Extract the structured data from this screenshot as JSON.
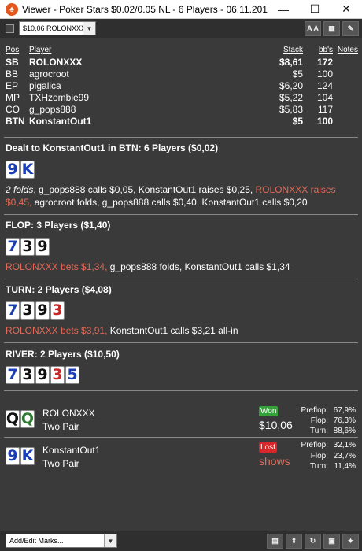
{
  "window": {
    "title": "Viewer - Poker Stars $0.02/0.05 NL - 6 Players - 06.11.2019 5:05",
    "app_icon": "pokerstars-icon",
    "controls": [
      "minimize-icon",
      "maximize-icon",
      "close-icon"
    ]
  },
  "toolbar": {
    "player_select": "$10,06 ROLONXXX",
    "buttons": [
      {
        "name": "text-size-button",
        "label": "A A"
      },
      {
        "name": "grid-button",
        "label": "▦"
      },
      {
        "name": "edit-button",
        "label": "✎"
      }
    ]
  },
  "players_table": {
    "headers": {
      "pos": "Pos",
      "player": "Player",
      "stack": "Stack",
      "bb": "bb's",
      "notes": "Notes"
    },
    "rows": [
      {
        "pos": "SB",
        "player": "ROLONXXX",
        "stack": "$8,61",
        "bb": "172",
        "bold": true
      },
      {
        "pos": "BB",
        "player": "agrocroot",
        "stack": "$5",
        "bb": "100",
        "bold": false
      },
      {
        "pos": "EP",
        "player": "pigalica",
        "stack": "$6,20",
        "bb": "124",
        "bold": false
      },
      {
        "pos": "MP",
        "player": "TXHzombie99",
        "stack": "$5,22",
        "bb": "104",
        "bold": false
      },
      {
        "pos": "CO",
        "player": "g_pops888",
        "stack": "$5,83",
        "bb": "117",
        "bold": false
      },
      {
        "pos": "BTN",
        "player": "KonstantOut1",
        "stack": "$5",
        "bb": "100",
        "bold": true
      }
    ]
  },
  "preflop": {
    "title": "Dealt to KonstantOut1 in BTN: 6 Players ($0,02)",
    "cards": [
      {
        "rank": "9",
        "color": "#1a3fb5"
      },
      {
        "rank": "K",
        "color": "#1a3fb5"
      }
    ],
    "action": [
      {
        "text": "2 folds",
        "style": "italic"
      },
      {
        "text": ", g_pops888 calls $0,05, KonstantOut1 raises $0,25, ",
        "style": "normal"
      },
      {
        "text": "ROLONXXX raises $0,45,",
        "style": "red"
      },
      {
        "text": " agrocroot folds, g_pops888 calls $0,40, KonstantOut1 calls $0,20",
        "style": "normal"
      }
    ]
  },
  "flop": {
    "title": "FLOP: 3 Players ($1,40)",
    "cards": [
      {
        "rank": "7",
        "color": "#1a3fb5"
      },
      {
        "rank": "3",
        "color": "#111111"
      },
      {
        "rank": "9",
        "color": "#111111"
      }
    ],
    "action": [
      {
        "text": "ROLONXXX bets $1,34,",
        "style": "red"
      },
      {
        "text": " g_pops888 folds, KonstantOut1 calls $1,34",
        "style": "normal"
      }
    ]
  },
  "turn": {
    "title": "TURN: 2 Players ($4,08)",
    "cards": [
      {
        "rank": "7",
        "color": "#1a3fb5"
      },
      {
        "rank": "3",
        "color": "#111111"
      },
      {
        "rank": "9",
        "color": "#111111"
      },
      {
        "rank": "3",
        "color": "#c62828"
      }
    ],
    "action": [
      {
        "text": "ROLONXXX bets $3,91,",
        "style": "red"
      },
      {
        "text": " KonstantOut1 calls $3,21 all-in",
        "style": "normal"
      }
    ]
  },
  "river": {
    "title": "RIVER: 2 Players ($10,50)",
    "cards": [
      {
        "rank": "7",
        "color": "#1a3fb5"
      },
      {
        "rank": "3",
        "color": "#111111"
      },
      {
        "rank": "9",
        "color": "#111111"
      },
      {
        "rank": "3",
        "color": "#c62828"
      },
      {
        "rank": "5",
        "color": "#1a3fb5"
      }
    ]
  },
  "showdown": [
    {
      "name": "ROLONXXX",
      "hand": "Two Pair",
      "cards": [
        {
          "rank": "Q",
          "color": "#111111"
        },
        {
          "rank": "Q",
          "color": "#2e7d32"
        }
      ],
      "result": "Won",
      "amount": "$10,06",
      "stats": [
        {
          "label": "Preflop:",
          "value": "67,9%"
        },
        {
          "label": "Flop:",
          "value": "76,3%"
        },
        {
          "label": "Turn:",
          "value": "88,6%"
        }
      ]
    },
    {
      "name": "KonstantOut1",
      "hand": "Two Pair",
      "cards": [
        {
          "rank": "9",
          "color": "#1a3fb5"
        },
        {
          "rank": "K",
          "color": "#1a3fb5"
        }
      ],
      "result": "Lost",
      "amount": "shows",
      "stats": [
        {
          "label": "Preflop:",
          "value": "32,1%"
        },
        {
          "label": "Flop:",
          "value": "23,7%"
        },
        {
          "label": "Turn:",
          "value": "11,4%"
        }
      ]
    }
  ],
  "bottombar": {
    "marks_select": "Add/Edit Marks...",
    "buttons": [
      {
        "name": "calculator-button",
        "label": "▤"
      },
      {
        "name": "stepper-button",
        "label": "⇕"
      },
      {
        "name": "replay-button",
        "label": "↻"
      },
      {
        "name": "save-button",
        "label": "▣"
      },
      {
        "name": "twitter-button",
        "label": "✦"
      }
    ]
  }
}
